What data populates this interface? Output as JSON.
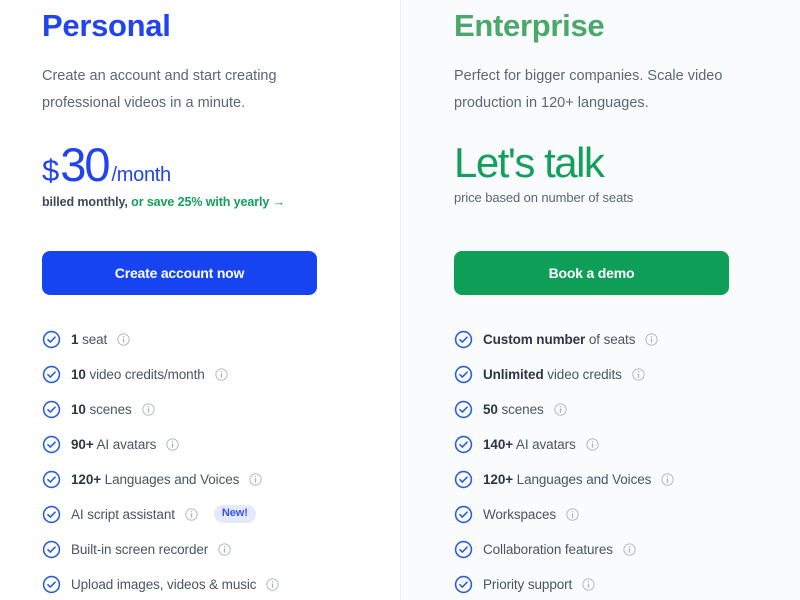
{
  "plans": [
    {
      "id": "personal",
      "title": "Personal",
      "description": "Create an account and start creating professional videos in a minute.",
      "price": {
        "currency": "$",
        "amount": "30",
        "period": "/month",
        "note_prefix": "billed monthly,",
        "note_link": "or save 25% with yearly →"
      },
      "cta_label": "Create account now",
      "features": [
        {
          "lead": "1",
          "rest": " seat",
          "info": true
        },
        {
          "lead": "10",
          "rest": " video credits/month",
          "info": true
        },
        {
          "lead": "10",
          "rest": " scenes",
          "info": true
        },
        {
          "lead": "90+",
          "rest": " AI avatars",
          "info": true
        },
        {
          "lead": "120+",
          "rest": " Languages and Voices",
          "info": true
        },
        {
          "lead": "",
          "rest": "AI script assistant",
          "info": true,
          "badge": "New!"
        },
        {
          "lead": "",
          "rest": "Built-in screen recorder",
          "info": true
        },
        {
          "lead": "",
          "rest": "Upload images, videos & music",
          "info": true
        }
      ]
    },
    {
      "id": "enterprise",
      "title": "Enterprise",
      "description": "Perfect for bigger companies. Scale video production in 120+ languages.",
      "price": {
        "headline": "Let's talk",
        "note": "price based on number of seats"
      },
      "cta_label": "Book a demo",
      "features": [
        {
          "lead": "Custom number",
          "rest": " of seats",
          "info": true
        },
        {
          "lead": "Unlimited",
          "rest": " video credits",
          "info": true
        },
        {
          "lead": "50",
          "rest": " scenes",
          "info": true
        },
        {
          "lead": "140+",
          "rest": " AI avatars",
          "info": true
        },
        {
          "lead": "120+",
          "rest": " Languages and Voices",
          "info": true
        },
        {
          "lead": "",
          "rest": "Workspaces",
          "info": true
        },
        {
          "lead": "",
          "rest": "Collaboration features",
          "info": true
        },
        {
          "lead": "",
          "rest": "Priority support",
          "info": true
        }
      ]
    }
  ],
  "colors": {
    "personal_accent": "#2244ee",
    "personal_button": "#1544f0",
    "enterprise_accent": "#4aa86a",
    "enterprise_button": "#0f9e58",
    "save_link": "#12a05c",
    "check": "#2a5fdb",
    "badge_bg": "#e6e8fc",
    "badge_text": "#3355ee"
  }
}
